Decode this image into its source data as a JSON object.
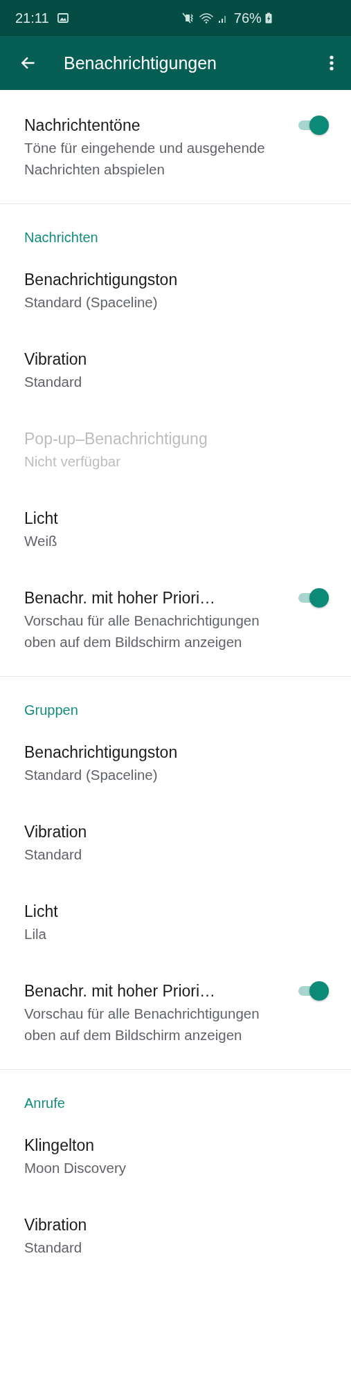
{
  "status_bar": {
    "time": "21:11",
    "battery": "76%"
  },
  "app_bar": {
    "title": "Benachrichtigungen"
  },
  "sections": [
    {
      "items": [
        {
          "kind": "toggle",
          "title": "Nachrichtentöne",
          "subtitle": "Töne für eingehende und ausgehende Nachrichten abspielen",
          "on": true,
          "disabled": false
        }
      ]
    },
    {
      "header": "Nachrichten",
      "items": [
        {
          "kind": "plain",
          "title": "Benachrichtigungston",
          "subtitle": "Standard (Spaceline)",
          "disabled": false
        },
        {
          "kind": "plain",
          "title": "Vibration",
          "subtitle": "Standard",
          "disabled": false
        },
        {
          "kind": "plain",
          "title": "Pop-up–Benachrichtigung",
          "subtitle": "Nicht verfügbar",
          "disabled": true
        },
        {
          "kind": "plain",
          "title": "Licht",
          "subtitle": "Weiß",
          "disabled": false
        },
        {
          "kind": "toggle",
          "title": "Benachr. mit hoher Priori…",
          "subtitle": "Vorschau für alle Benachrichtigungen oben auf dem Bildschirm anzeigen",
          "on": true,
          "disabled": false
        }
      ]
    },
    {
      "header": "Gruppen",
      "items": [
        {
          "kind": "plain",
          "title": "Benachrichtigungston",
          "subtitle": "Standard (Spaceline)",
          "disabled": false
        },
        {
          "kind": "plain",
          "title": "Vibration",
          "subtitle": "Standard",
          "disabled": false
        },
        {
          "kind": "plain",
          "title": "Licht",
          "subtitle": "Lila",
          "disabled": false
        },
        {
          "kind": "toggle",
          "title": "Benachr. mit hoher Priori…",
          "subtitle": "Vorschau für alle Benachrichtigungen oben auf dem Bildschirm anzeigen",
          "on": true,
          "disabled": false
        }
      ]
    },
    {
      "header": "Anrufe",
      "items": [
        {
          "kind": "plain",
          "title": "Klingelton",
          "subtitle": "Moon Discovery",
          "disabled": false
        },
        {
          "kind": "plain",
          "title": "Vibration",
          "subtitle": "Standard",
          "disabled": false
        }
      ]
    }
  ]
}
